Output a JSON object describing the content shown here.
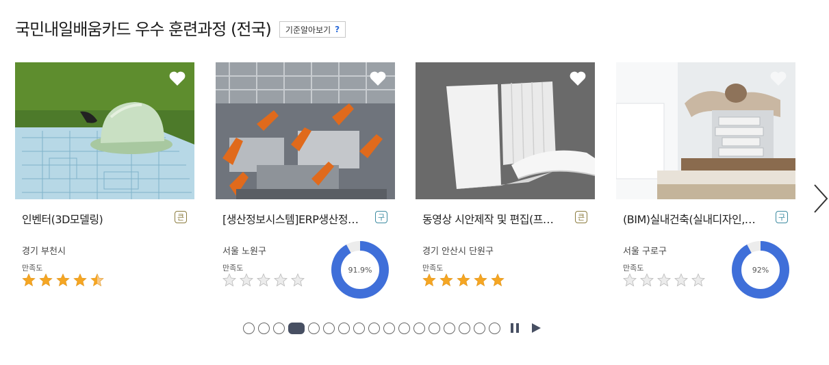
{
  "header": {
    "title": "국민내일배움카드 우수 훈련과정 (전국)",
    "criteria_button": "기준알아보기",
    "criteria_icon": "?"
  },
  "cards": [
    {
      "title": "인벤터(3D모델링)",
      "badge": "큰",
      "badge_color": "#8a7a3c",
      "location": "경기 부천시",
      "satisfaction_label": "만족도",
      "stars_filled": 4.5,
      "image": "hard-hat-on-blueprint"
    },
    {
      "title": "[생산정보시스템]ERP생산정…",
      "badge": "구",
      "badge_color": "#3b8aa0",
      "location": "서울 노원구",
      "satisfaction_label": "만족도",
      "stars_filled": 0,
      "donut_label": "91.9%",
      "donut_value": 0.919,
      "image": "robotic-assembly-line"
    },
    {
      "title": "동영상 시안제작 및 편집(프…",
      "badge": "큰",
      "badge_color": "#8a7a3c",
      "location": "경기 안산시 단원구",
      "satisfaction_label": "만족도",
      "stars_filled": 5,
      "image": "blank-books"
    },
    {
      "title": "(BIM)실내건축(실내디자인,…",
      "badge": "구",
      "badge_color": "#3b8aa0",
      "location": "서울 구로구",
      "satisfaction_label": "만족도",
      "stars_filled": 0,
      "donut_label": "92%",
      "donut_value": 0.92,
      "image": "architectural-model"
    }
  ],
  "pager": {
    "count": 17,
    "active_index": 3
  },
  "colors": {
    "accent": "#3f6fd9",
    "star": "#f5a623",
    "star_empty": "#c9c9c9",
    "dot_active": "#474f62"
  }
}
